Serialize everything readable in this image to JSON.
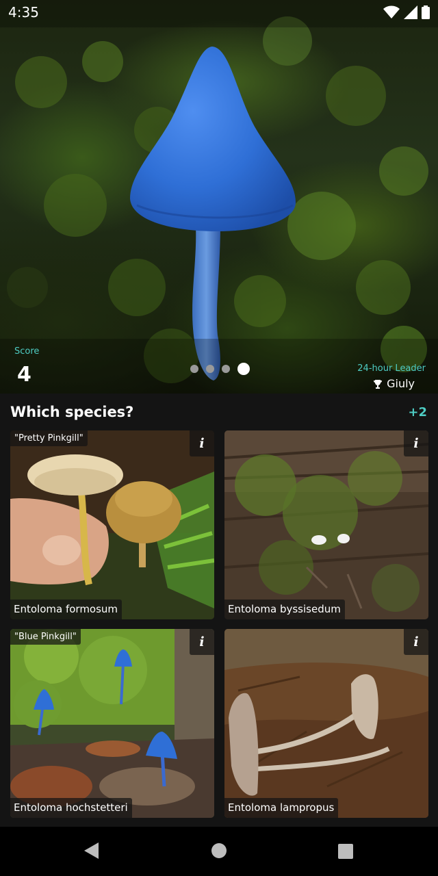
{
  "status_bar": {
    "time": "4:35",
    "icons": [
      "wifi-icon",
      "cellular-signal-icon",
      "battery-icon"
    ]
  },
  "hero": {
    "score_label": "Score",
    "score_value": "4",
    "leader_label": "24-hour Leader",
    "leader_name": "Giuly",
    "leader_icon": "trophy-icon",
    "pager": {
      "count": 4,
      "active_index": 3
    }
  },
  "quiz": {
    "question": "Which species?",
    "bonus": "+2",
    "options": [
      {
        "common_name": "\"Pretty Pinkgill\"",
        "species": "Entoloma formosum",
        "info": "i"
      },
      {
        "common_name": "",
        "species": "Entoloma byssisedum",
        "info": "i"
      },
      {
        "common_name": "\"Blue Pinkgill\"",
        "species": "Entoloma hochstetteri",
        "info": "i"
      },
      {
        "common_name": "",
        "species": "Entoloma lampropus",
        "info": "i"
      }
    ]
  },
  "nav": {
    "buttons": [
      "back-icon",
      "home-icon",
      "recents-icon"
    ]
  },
  "colors": {
    "accent": "#4ecdc4",
    "background": "#141414",
    "mushroom_blue": "#2f6fd6"
  }
}
